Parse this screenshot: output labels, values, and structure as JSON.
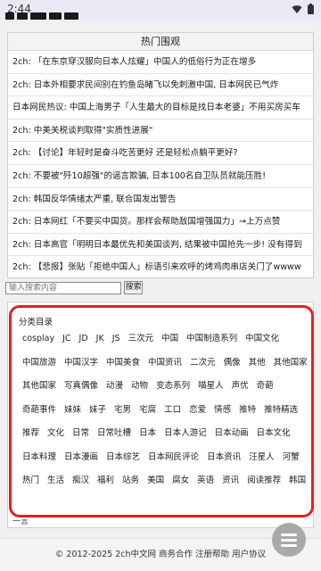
{
  "status_bar": {
    "time": "2:44",
    "icons": [
      "wifi-icon",
      "battery-icon"
    ]
  },
  "site": {
    "logo_icon": "site-logo"
  },
  "hot": {
    "title": "热门围观",
    "items": [
      "2ch: 「在东京穿汉服向日本人炫耀」中国人的低俗行为正在增多",
      "2ch: 日本外相要求民间别在钓鱼岛睹飞以免刺激中国, 日本网民已气炸",
      "日本网民热议: 中国上海男子「人生最大的目标是找日本老婆」不用买房买车",
      "2ch: 中美关税谈判取得\"实质性进展\"",
      "2ch: 【讨论】年轻时是奋斗吃苦更好 还是轻松点躺平更好?",
      "2ch: 不要被\"歼10超强\"的谣言欺骗, 日本100名自卫队员就能压胜!",
      "2ch: 韩国反华情绪太严重, 联合国发出警告",
      "2ch: 日本网红「不要买中国货。那样会帮助敌国增强国力」→上万点赞",
      "2ch: 日本高官「明明日本最优先和美国谈判, 结果被中国抢先一步! 没有得到",
      "2ch: 【悲报】张贴「拒绝中国人」标语引来欢呼的烤鸡肉串店关门了wwww"
    ]
  },
  "search": {
    "placeholder": "输入搜索内容",
    "button_label": "搜索"
  },
  "categories": {
    "title": "分类目录",
    "tags": [
      "cosplay",
      "JC",
      "JD",
      "JK",
      "JS",
      "三次元",
      "中国",
      "中国制造系列",
      "中国文化",
      "中国旅游",
      "中国汉字",
      "中国美食",
      "中国资讯",
      "二次元",
      "偶像",
      "其他",
      "其他国家",
      "其他国家",
      "写真偶像",
      "动漫",
      "动物",
      "变态系列",
      "喵星人",
      "声优",
      "奇葩",
      "奇葩事件",
      "妹妹",
      "妹子",
      "宅男",
      "宅腐",
      "工口",
      "恋爱",
      "情感",
      "推特",
      "推特精选",
      "推荐",
      "文化",
      "日常",
      "日常吐槽",
      "日本",
      "日本人游记",
      "日本动画",
      "日本文化",
      "日本料理",
      "日本漫画",
      "日本综艺",
      "日本网民评论",
      "日本资讯",
      "汪星人",
      "河蟹",
      "热门",
      "生活",
      "痴汉",
      "福利",
      "站务",
      "美国",
      "腐女",
      "英语",
      "资讯",
      "阅读推荐",
      "韩国"
    ]
  },
  "partial_text": "一言",
  "footer": {
    "text": "© 2012-2025 2ch中文网 商务合作 注册帮助 用户协议"
  },
  "fab": {
    "icon": "menu-icon"
  },
  "colors": {
    "highlight": "#e8201c",
    "fab": "#a9a9a9"
  }
}
